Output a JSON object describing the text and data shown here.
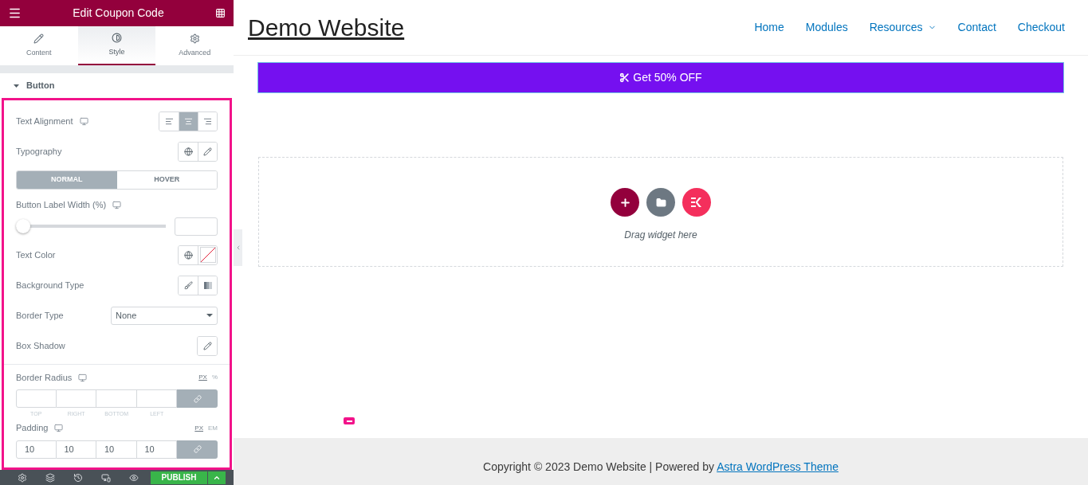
{
  "panel": {
    "title": "Edit Coupon Code",
    "tabs": [
      {
        "label": "Content",
        "selected": false
      },
      {
        "label": "Style",
        "selected": true
      },
      {
        "label": "Advanced",
        "selected": false
      }
    ],
    "section": {
      "title": "Button",
      "expanded": true
    },
    "controls": [
      {
        "kind": "align",
        "label": "Text Alignment",
        "responsive": true,
        "options": [
          {
            "selected": false
          },
          {
            "selected": true
          },
          {
            "selected": false
          }
        ]
      },
      {
        "kind": "typography",
        "label": "Typography"
      },
      {
        "kind": "toggle",
        "options": [
          {
            "label": "NORMAL",
            "selected": true
          },
          {
            "label": "HOVER",
            "selected": false
          }
        ]
      },
      {
        "kind": "slider",
        "label": "Button Label Width (%)",
        "responsive": true,
        "level": 0
      },
      {
        "kind": "color",
        "label": "Text Color"
      },
      {
        "kind": "background",
        "label": "Background Type"
      },
      {
        "kind": "select",
        "label": "Border Type",
        "value": "None"
      },
      {
        "kind": "popover",
        "label": "Box Shadow"
      },
      {
        "kind": "divider"
      },
      {
        "kind": "dimensions",
        "label": "Border Radius",
        "responsive": true,
        "units": [
          {
            "label": "PX",
            "selected": true
          },
          {
            "label": "%",
            "selected": false
          }
        ],
        "linked": true,
        "fields": [
          {
            "caption": "TOP"
          },
          {
            "caption": "RIGHT"
          },
          {
            "caption": "BOTTOM"
          },
          {
            "caption": "LEFT"
          }
        ]
      },
      {
        "kind": "dimensions",
        "label": "Padding",
        "responsive": true,
        "units": [
          {
            "label": "PX",
            "selected": true
          },
          {
            "label": "EM",
            "selected": false
          }
        ],
        "linked": true,
        "fields": [
          {
            "value": "10"
          },
          {
            "value": "10"
          },
          {
            "value": "10"
          },
          {
            "value": "10"
          }
        ]
      }
    ],
    "footer": {
      "publish": "PUBLISH"
    }
  },
  "site": {
    "title": "Demo Website",
    "nav": [
      {
        "label": "Home",
        "dropdown": false
      },
      {
        "label": "Modules",
        "dropdown": false
      },
      {
        "label": "Resources",
        "dropdown": true
      },
      {
        "label": "Contact",
        "dropdown": false
      },
      {
        "label": "Checkout",
        "dropdown": false
      }
    ],
    "coupon_button": "Get 50% OFF",
    "drop_zone": {
      "hint": "Drag widget here"
    },
    "footer": {
      "text": "Copyright © 2023 Demo Website | Powered by ",
      "link": "Astra WordPress Theme"
    }
  }
}
